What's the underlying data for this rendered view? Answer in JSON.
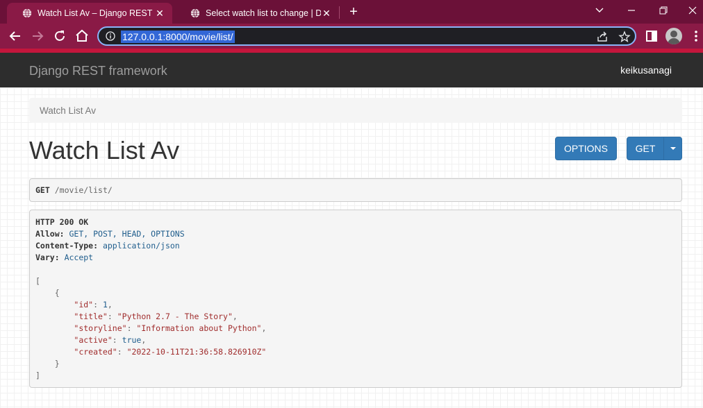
{
  "browser": {
    "tabs": [
      {
        "title": "Watch List Av – Django REST framework",
        "active": true
      },
      {
        "title": "Select watch list to change | Django site admin",
        "active": false
      }
    ],
    "url": "127.0.0.1:8000/movie/list/"
  },
  "navbar": {
    "brand": "Django REST framework",
    "user": "keikusanagi"
  },
  "breadcrumb": {
    "current": "Watch List Av"
  },
  "page": {
    "title": "Watch List Av",
    "options_label": "OPTIONS",
    "get_label": "GET"
  },
  "request": {
    "method": "GET",
    "path": "/movie/list/"
  },
  "response": {
    "status": "HTTP 200 OK",
    "headers": {
      "allow_key": "Allow:",
      "allow_value": "GET, POST, HEAD, OPTIONS",
      "content_type_key": "Content-Type:",
      "content_type_value": "application/json",
      "vary_key": "Vary:",
      "vary_value": "Accept"
    },
    "body": {
      "id_key": "\"id\"",
      "id_value": "1",
      "title_key": "\"title\"",
      "title_value": "\"Python 2.7 - The Story\"",
      "storyline_key": "\"storyline\"",
      "storyline_value": "\"Information about Python\"",
      "active_key": "\"active\"",
      "active_value": "true",
      "created_key": "\"created\"",
      "created_value": "\"2022-10-11T21:36:58.826910Z\""
    }
  },
  "colors": {
    "tab_strip": "#6b1138",
    "toolbar": "#8a1a46",
    "navbar": "#2d2d2d",
    "button_primary": "#337ab7"
  }
}
